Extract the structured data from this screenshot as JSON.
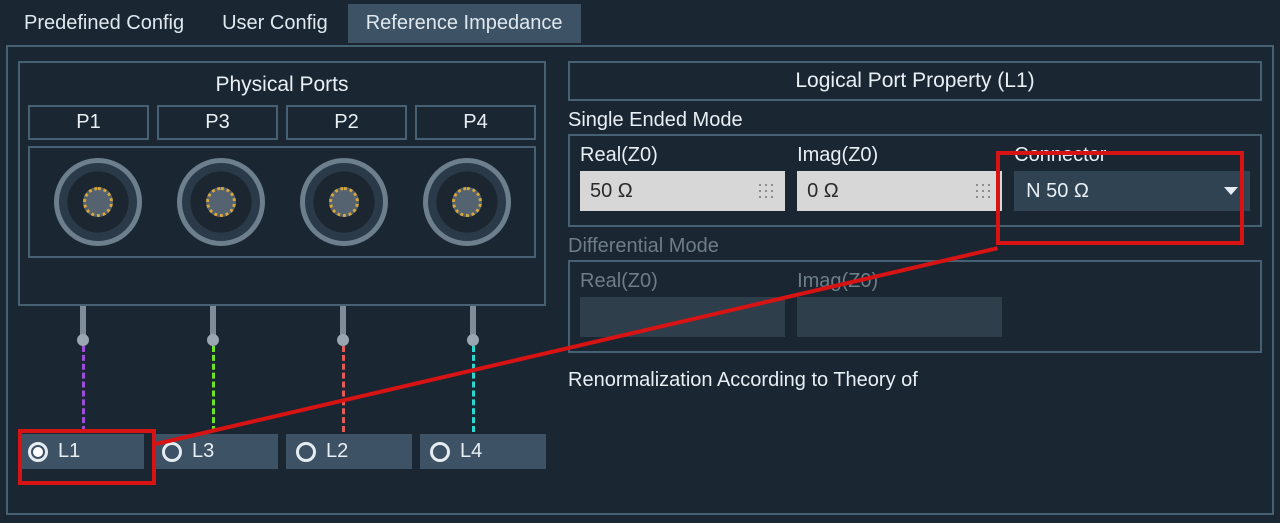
{
  "tabs": {
    "predefined": "Predefined Config",
    "user": "User Config",
    "refimp": "Reference Impedance"
  },
  "physical_ports": {
    "title": "Physical Ports",
    "ports": [
      {
        "label": "P1",
        "logical": "L1",
        "wire_color": "#9c4ed8",
        "selected": true
      },
      {
        "label": "P3",
        "logical": "L3",
        "wire_color": "#6de22a",
        "selected": false
      },
      {
        "label": "P2",
        "logical": "L2",
        "wire_color": "#e25a5a",
        "selected": false
      },
      {
        "label": "P4",
        "logical": "L4",
        "wire_color": "#2ad8d0",
        "selected": false
      }
    ]
  },
  "property": {
    "title": "Logical Port Property (L1)",
    "single": {
      "label": "Single Ended Mode",
      "real_label": "Real(Z0)",
      "imag_label": "Imag(Z0)",
      "connector_label": "Connector",
      "real_value": "50 Ω",
      "imag_value": "0 Ω",
      "connector_value": "N 50 Ω"
    },
    "diff": {
      "label": "Differential Mode",
      "real_label": "Real(Z0)",
      "imag_label": "Imag(Z0)"
    },
    "renorm_label": "Renormalization According to Theory of"
  }
}
